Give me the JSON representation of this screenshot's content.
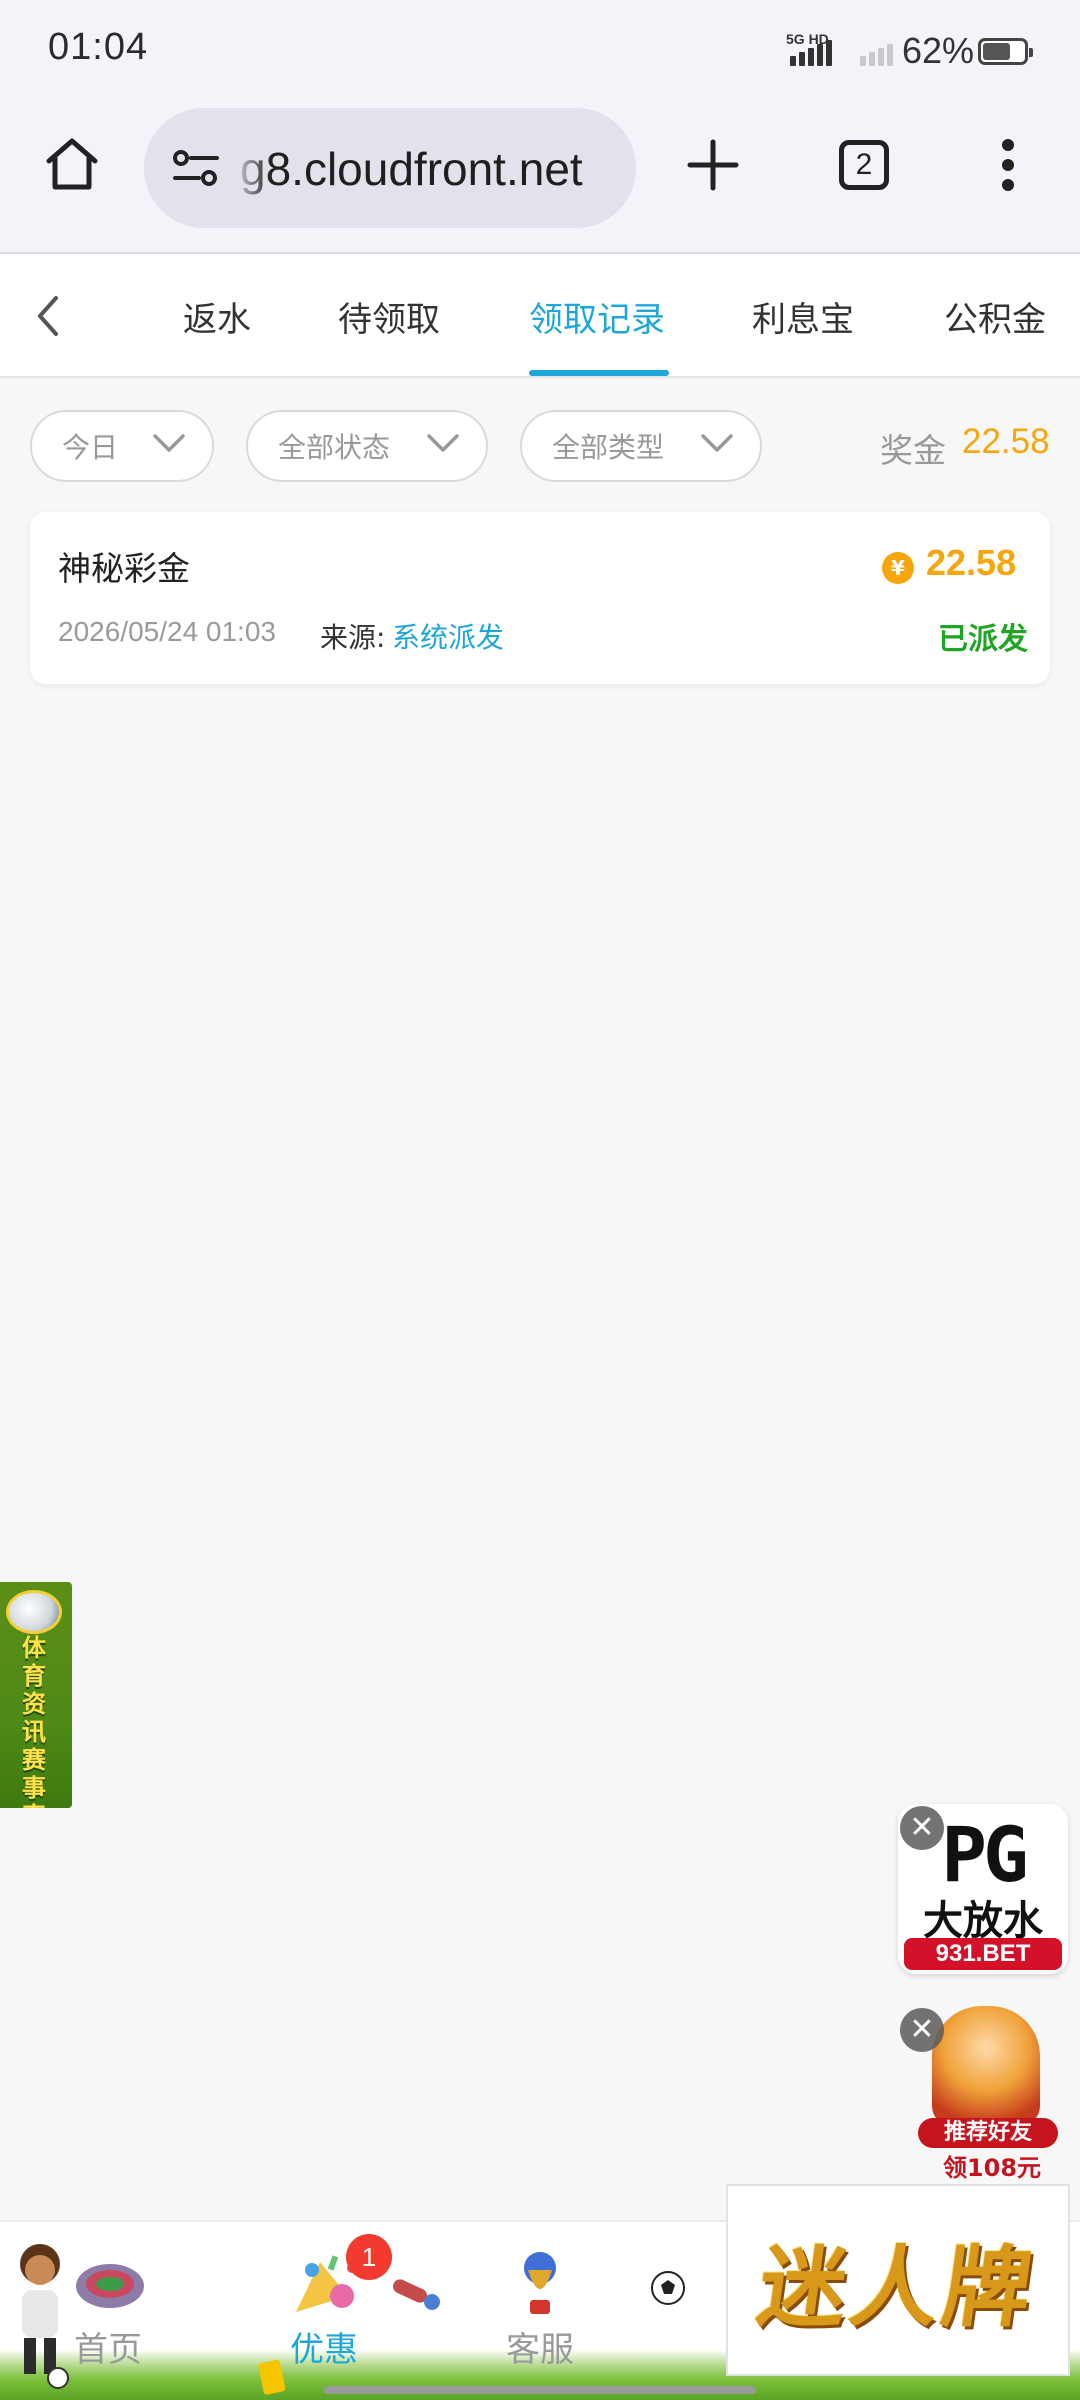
{
  "status_bar": {
    "time": "01:04",
    "network_top": "5G HD",
    "battery": "62%",
    "battery_level": 0.62
  },
  "browser": {
    "url": "g8.cloudfront.net",
    "tab_count": "2"
  },
  "tabs": [
    {
      "label": "返水",
      "active": false
    },
    {
      "label": "待领取",
      "active": false
    },
    {
      "label": "领取记录",
      "active": true
    },
    {
      "label": "利息宝",
      "active": false
    },
    {
      "label": "公积金",
      "active": false
    }
  ],
  "filters": {
    "date": "今日",
    "status": "全部状态",
    "type": "全部类型"
  },
  "bonus": {
    "label": "奖金",
    "value": "22.58"
  },
  "record": {
    "title": "神秘彩金",
    "coin_symbol": "¥",
    "amount": "22.58",
    "date": "2026/05/24 01:03",
    "source_label": "来源:",
    "source": "系统派发",
    "status": "已派发"
  },
  "side_banner": {
    "text": "体育资讯赛事直播"
  },
  "ads": {
    "pg_logo": "PG",
    "pg_title": "大放水",
    "pg_url": "931.BET",
    "friend_label": "推荐好友",
    "friend_amount": "领108元",
    "brand": "迷人牌"
  },
  "bottom_nav": [
    {
      "label": "首页",
      "active": false
    },
    {
      "label": "优惠",
      "active": true,
      "badge": "1"
    },
    {
      "label": "客服",
      "active": false
    }
  ],
  "colors": {
    "accent": "#1da6da",
    "gold": "#f6a50c",
    "success": "#1fa524",
    "badge": "#f33a2f"
  }
}
